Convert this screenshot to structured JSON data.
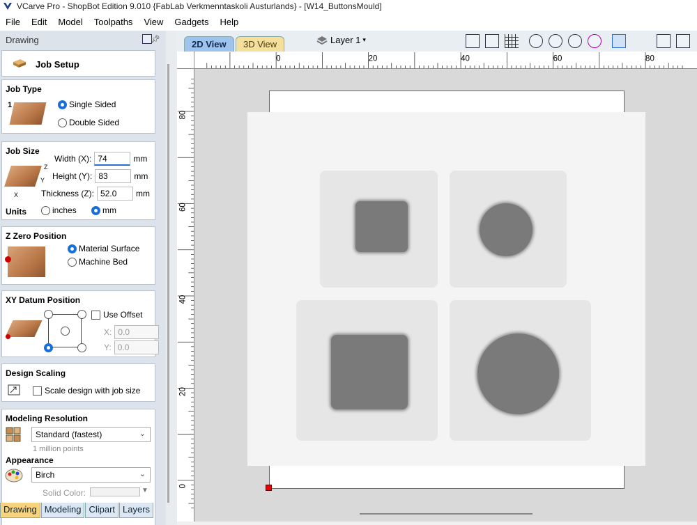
{
  "titlebar": {
    "title": "VCarve Pro - ShopBot Edition 9.010 {FabLab Verkmenntaskoli Austurlands} - [W14_ButtonsMould]"
  },
  "menu": [
    "File",
    "Edit",
    "Model",
    "Toolpaths",
    "View",
    "Gadgets",
    "Help"
  ],
  "panel": {
    "title": "Drawing",
    "job_setup": "Job Setup",
    "job_type": {
      "heading": "Job Type",
      "single": "Single Sided",
      "double": "Double Sided",
      "sides_index": "1",
      "selected": "single"
    },
    "job_size": {
      "heading": "Job Size",
      "width_label": "Width (X):",
      "width": "74",
      "height_label": "Height (Y):",
      "height": "83",
      "thickness_label": "Thickness (Z):",
      "thickness": "52.0",
      "unit": "mm",
      "units_label": "Units",
      "inches": "inches",
      "mm": "mm",
      "selected": "mm",
      "axis_x": "X",
      "axis_y": "Y",
      "axis_z": "Z"
    },
    "z_zero": {
      "heading": "Z Zero Position",
      "material_surface": "Material Surface",
      "machine_bed": "Machine Bed",
      "selected": "material_surface"
    },
    "xy_datum": {
      "heading": "XY Datum Position",
      "use_offset": "Use Offset",
      "x_label": "X:",
      "x": "0.0",
      "y_label": "Y:",
      "y": "0.0"
    },
    "design_scaling": {
      "heading": "Design Scaling",
      "scale_label": "Scale design with job size"
    },
    "modeling_resolution": {
      "heading": "Modeling Resolution",
      "value": "Standard (fastest)",
      "note": "1 million points"
    },
    "appearance": {
      "heading": "Appearance",
      "value": "Birch",
      "solid_color_label": "Solid Color:"
    }
  },
  "bottom_tabs": [
    "Drawing",
    "Modeling",
    "Clipart",
    "Layers"
  ],
  "view": {
    "tab_2d": "2D View",
    "tab_3d": "3D View",
    "layer": "Layer 1",
    "ruler_h": [
      "0",
      "20",
      "40",
      "60",
      "80"
    ],
    "ruler_v": [
      "80",
      "60",
      "40",
      "20",
      "0"
    ]
  },
  "colors": {
    "accent": "#1a6ed8",
    "origin": "#e00000",
    "shape": "#7a7a7a"
  }
}
